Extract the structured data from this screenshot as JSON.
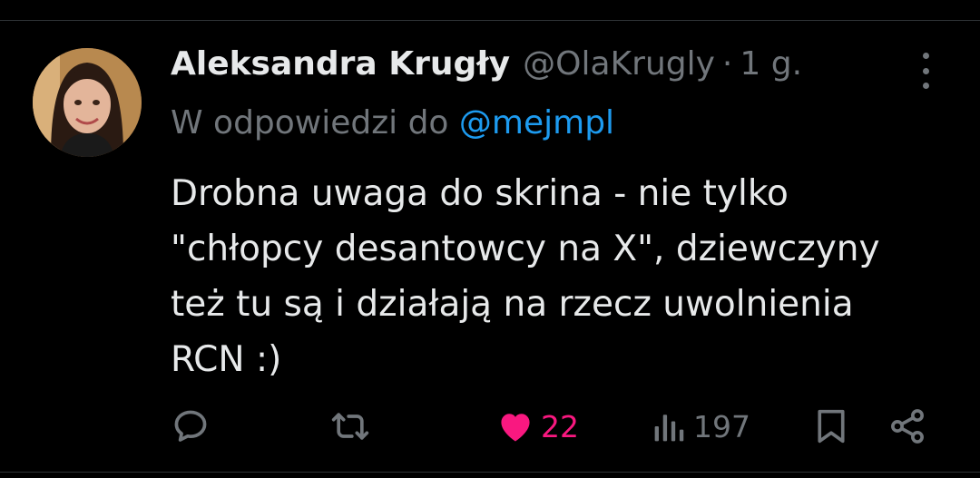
{
  "post": {
    "author_name": "Aleksandra Krugły",
    "author_handle": "@OlaKrugly",
    "time_separator": "·",
    "time": "1 g.",
    "reply_prefix": "W odpowiedzi do",
    "reply_to": "@mejmpl",
    "text_lines": [
      "Drobna uwaga do skrina - nie tylko",
      "\"chłopcy desantowcy na X\", dziewczyny",
      "też tu są i działają na rzecz uwolnienia",
      "RCN :)"
    ]
  },
  "actions": {
    "like_count": "22",
    "views_count": "197"
  },
  "colors": {
    "background": "#000000",
    "text": "#e7e9ea",
    "secondary": "#71767b",
    "link": "#1d9bf0",
    "like": "#f91880",
    "divider": "#2f3336"
  },
  "icons": {
    "reply": "reply-icon",
    "repost": "repost-icon",
    "like": "heart-icon",
    "views": "views-icon",
    "bookmark": "bookmark-icon",
    "share": "share-icon",
    "more": "more-icon"
  }
}
